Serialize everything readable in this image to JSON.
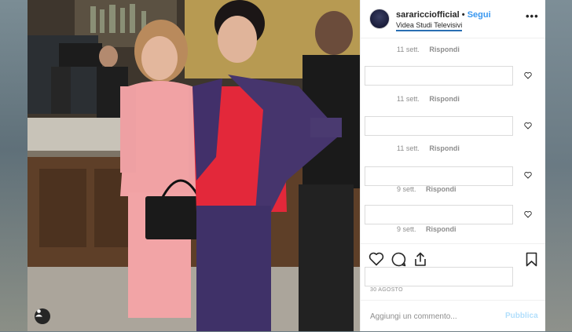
{
  "post": {
    "username": "sararicciofficial",
    "separator": "•",
    "follow_label": "Segui",
    "location": "Videa Studi Televisivi",
    "more_label": "•••"
  },
  "comments": [
    {
      "when": "11 sett.",
      "reply": "Rispondi"
    },
    {
      "when": "11 sett.",
      "reply": "Rispondi"
    },
    {
      "when": "11 sett.",
      "reply": "Rispondi"
    },
    {
      "when": "9 sett.",
      "reply": "Rispondi"
    },
    {
      "when": "9 sett.",
      "reply": "Rispondi"
    }
  ],
  "footer": {
    "date": "30 AGOSTO",
    "comment_placeholder": "Aggiungi un commento...",
    "publish_label": "Pubblica"
  },
  "colors": {
    "accent": "#3897f0",
    "publish_disabled": "#b2dffc",
    "muted_text": "#8e8e8e"
  },
  "icons": [
    "user-tag-icon",
    "more-options-icon",
    "heart-icon",
    "comment-icon",
    "share-icon",
    "bookmark-icon"
  ]
}
